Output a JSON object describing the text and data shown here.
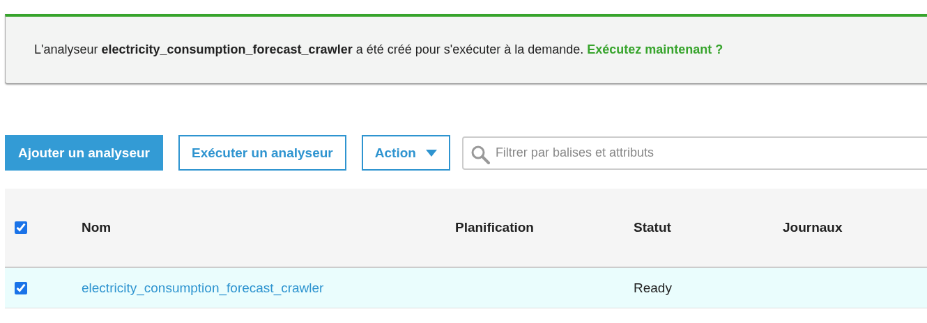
{
  "notification": {
    "message": "L'analyseur **electricity_consumption_forecast_crawler** a été créé pour s'exécuter à la demande.",
    "link": "Exécutez maintenant ?"
  },
  "toolbar": {
    "buttons": [
      {
        "label": "Ajouter un analyseur",
        "kind": "primary"
      },
      {
        "label": "Exécuter un analyseur",
        "kind": "secondary"
      },
      {
        "label": "Action",
        "kind": "dropdown"
      }
    ],
    "search": {
      "placeholder": "Filtrer par balises et attributs"
    }
  },
  "table": {
    "select_all": {
      "checked": true
    },
    "columns": [
      "Nom",
      "Planification",
      "Statut",
      "Journaux"
    ],
    "rows": [
      {
        "selected": true,
        "name": "electricity_consumption_forecast_crawler",
        "status": "Ready"
      }
    ]
  }
}
